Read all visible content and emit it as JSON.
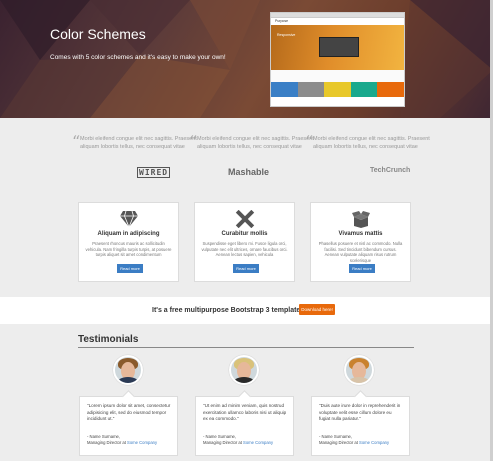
{
  "hero": {
    "title": "Color Schemes",
    "subtitle": "Comes with 5 color schemes and it's easy to make your own!",
    "preview": {
      "logo": "Purpose",
      "banner_text": "Responsive",
      "swatch_colors": [
        "#3a7fc6",
        "#8c8c8c",
        "#e8c82a",
        "#1aa98d",
        "#e8690b"
      ]
    }
  },
  "quotes": [
    {
      "text": "Morbi eleifend congue elit nec sagittis. Praesent aliquam lobortis tellus, nec consequat vitae",
      "source": "WIRED"
    },
    {
      "text": "Morbi eleifend congue elit nec sagittis. Praesent aliquam lobortis tellus, nec consequat vitae",
      "source": "Mashable"
    },
    {
      "text": "Morbi eleifend congue elit nec sagittis. Praesent aliquam lobortis tellus, nec consequat vitae",
      "source": "TechCrunch"
    }
  ],
  "features": [
    {
      "icon": "diamond-icon",
      "title": "Aliquam in adipiscing",
      "text": "Praesent rhoncus mauris ac sollicitudin vehicula. Nam fringilla turpis turpis, at posuere turpis aliquet sit amet condimentum",
      "button": "Read more"
    },
    {
      "icon": "pencil-ruler-icon",
      "title": "Curabitur mollis",
      "text": "Suspendisse eget libero mi. Fusce ligula orci, vulputate nec elit ultrices, ornare faucibus orci. Aenean lectus sapien, vehicula",
      "button": "Read more"
    },
    {
      "icon": "box-icon",
      "title": "Vivamus mattis",
      "text": "Phasellus posuere et nisl ac commodo. Nulla facilisi. Sed tincidunt bibendum cursus. Aenean vulputate aliquam risus rutrum scelerisque",
      "button": "Read more"
    }
  ],
  "cta": {
    "text": "It's a free multipurpose Bootstrap 3 template!",
    "button": "Download here!"
  },
  "testimonials": {
    "heading": "Testimonials",
    "items": [
      {
        "text": "\"Lorem ipsum dolor sit amet, consectetur adipisicing elit, sed do eiusmod tempor incididunt ut.\"",
        "name": "- Name Surname,",
        "role_prefix": "Managing Director at ",
        "company": "Some Company",
        "hair": "#8a5a2b",
        "shirt": "#2b3a55"
      },
      {
        "text": "\"Ut enim ad minim veniam, quis nostrud exercitation ullamco laboris nisi ut aliquip ex ea commodo.\"",
        "name": "- Name Surname,",
        "role_prefix": "Managing Director at ",
        "company": "Some Company",
        "hair": "#d9c27a",
        "shirt": "#2a2a2a"
      },
      {
        "text": "\"Duis aute irure dolor in reprehenderit in voluptate velit esse cillum dolore eu fugiat nulla pariatur.\"",
        "name": "- Name Surname,",
        "role_prefix": "Managing Director at ",
        "company": "Some Company",
        "hair": "#c9822f",
        "shirt": "#d8c3a8"
      }
    ]
  },
  "colors": {
    "accent_blue": "#3b7dc4",
    "accent_orange": "#e8690b"
  }
}
